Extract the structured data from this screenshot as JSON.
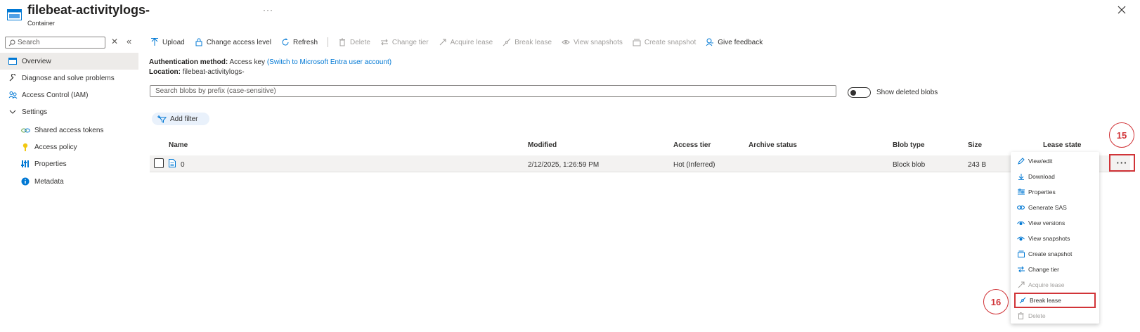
{
  "header": {
    "title": "filebeat-activitylogs-",
    "subtitle": "Container",
    "more": "···"
  },
  "sidebar": {
    "search_placeholder": "Search",
    "clear": "✕",
    "collapse": "«",
    "items": [
      {
        "label": "Overview",
        "icon": "container-icon",
        "selected": true
      },
      {
        "label": "Diagnose and solve problems",
        "icon": "wrench-icon"
      },
      {
        "label": "Access Control (IAM)",
        "icon": "people-icon"
      },
      {
        "label": "Settings",
        "icon": "chevron-down-icon"
      },
      {
        "label": "Shared access tokens",
        "icon": "link-icon"
      },
      {
        "label": "Access policy",
        "icon": "key-icon"
      },
      {
        "label": "Properties",
        "icon": "properties-icon"
      },
      {
        "label": "Metadata",
        "icon": "info-icon"
      }
    ]
  },
  "toolbar": {
    "upload": "Upload",
    "change_access": "Change access level",
    "refresh": "Refresh",
    "delete": "Delete",
    "change_tier": "Change tier",
    "acquire_lease": "Acquire lease",
    "break_lease": "Break lease",
    "view_snapshots": "View snapshots",
    "create_snapshot": "Create snapshot",
    "feedback": "Give feedback"
  },
  "info": {
    "auth_label": "Authentication method:",
    "auth_value": "Access key",
    "auth_link": "(Switch to Microsoft Entra user account)",
    "location_label": "Location:",
    "location_value": "filebeat-activitylogs-"
  },
  "blob_search_placeholder": "Search blobs by prefix (case-sensitive)",
  "show_deleted": "Show deleted blobs",
  "add_filter": "Add filter",
  "table": {
    "columns": [
      "Name",
      "Modified",
      "Access tier",
      "Archive status",
      "Blob type",
      "Size",
      "Lease state"
    ],
    "rows": [
      {
        "name": "0",
        "modified": "2/12/2025, 1:26:59 PM",
        "tier": "Hot (Inferred)",
        "archive": "",
        "type": "Block blob",
        "size": "243 B"
      }
    ],
    "row_more": "···"
  },
  "menu": {
    "items": [
      {
        "label": "View/edit",
        "icon": "pencil-icon"
      },
      {
        "label": "Download",
        "icon": "download-icon"
      },
      {
        "label": "Properties",
        "icon": "properties-icon"
      },
      {
        "label": "Generate SAS",
        "icon": "link-icon"
      },
      {
        "label": "View versions",
        "icon": "eye-icon"
      },
      {
        "label": "View snapshots",
        "icon": "eye-icon"
      },
      {
        "label": "Create snapshot",
        "icon": "snapshot-icon"
      },
      {
        "label": "Change tier",
        "icon": "swap-icon"
      },
      {
        "label": "Acquire lease",
        "icon": "lease-icon",
        "disabled": true
      },
      {
        "label": "Break lease",
        "icon": "break-lease-icon",
        "highlighted": true
      },
      {
        "label": "Delete",
        "icon": "trash-icon",
        "disabled": true
      }
    ]
  },
  "annotations": {
    "step_15": "15",
    "step_16": "16"
  },
  "colors": {
    "accent": "#0078d4",
    "annotation": "#d13438"
  }
}
